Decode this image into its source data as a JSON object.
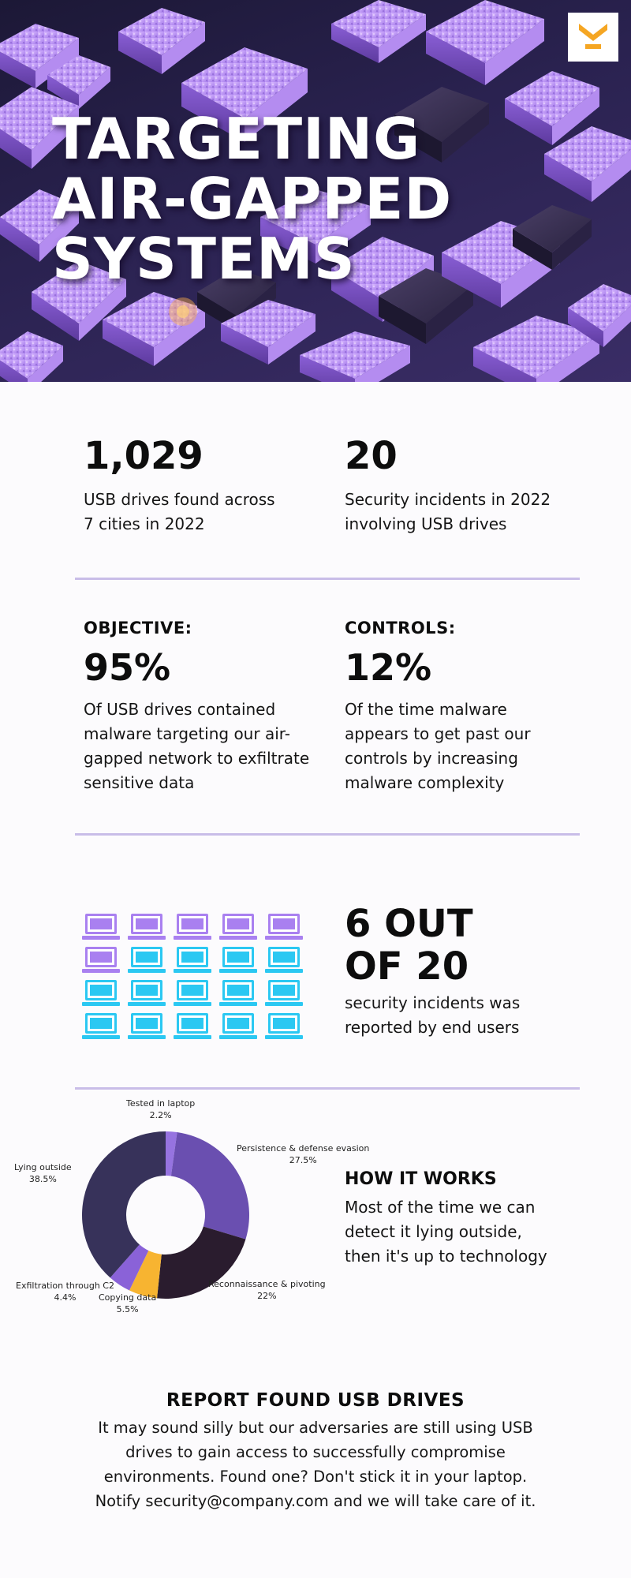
{
  "hero": {
    "title_lines": [
      "TARGETING",
      "AIR-GAPPED",
      "SYSTEMS"
    ],
    "logo_icon": "chevron-down-logo-icon",
    "accent_color": "#f5a623"
  },
  "stats": [
    {
      "number": "1,029",
      "desc_lines": [
        "USB drives found across",
        "7 cities in 2022"
      ]
    },
    {
      "number": "20",
      "desc_lines": [
        "Security incidents in 2022",
        "involving USB drives"
      ]
    }
  ],
  "objective": {
    "label": "OBJECTIVE:",
    "percent": "95%",
    "desc_lines": [
      "Of USB drives contained",
      "malware targeting our air-",
      "gapped network to exfiltrate",
      "sensitive data"
    ]
  },
  "controls": {
    "label": "CONTROLS:",
    "percent": "12%",
    "desc_lines": [
      "Of the time malware",
      "appears to get past our",
      "controls by increasing",
      "malware complexity"
    ]
  },
  "end_users": {
    "headline_lines": [
      "6 OUT",
      "OF 20"
    ],
    "desc_lines": [
      "security incidents was",
      "reported by end users"
    ],
    "icon": "laptop-icon",
    "highlighted": 6,
    "total": 20,
    "highlight_color": "#a980f0",
    "base_color": "#2bc8f2"
  },
  "chart_data": {
    "type": "pie",
    "donut": true,
    "slices": [
      {
        "label": "Tested in laptop",
        "value": 2.2,
        "display": "2.2%",
        "color": "#9673e0"
      },
      {
        "label": "Persistence & defense evasion",
        "value": 27.5,
        "display": "27.5%",
        "color": "#6a4fb0"
      },
      {
        "label": "Reconnaissance & pivoting",
        "value": 22,
        "display": "22%",
        "color": "#2a1c2e"
      },
      {
        "label": "Copying data",
        "value": 5.5,
        "display": "5.5%",
        "color": "#f7b431"
      },
      {
        "label": "Exfiltration through C2",
        "value": 4.4,
        "display": "4.4%",
        "color": "#8a62d8"
      },
      {
        "label": "Lying outside",
        "value": 38.5,
        "display": "38.5%",
        "color": "#37325a"
      }
    ]
  },
  "how_it_works": {
    "title": "HOW IT WORKS",
    "desc_lines": [
      "Most of the time we can",
      "detect it lying outside,",
      "then it's up to technology"
    ]
  },
  "report": {
    "title": "REPORT FOUND USB DRIVES",
    "desc_lines": [
      "It may sound silly but our adversaries are still using USB",
      "drives to gain access to successfully compromise",
      "environments. Found one? Don't stick it in your laptop.",
      "Notify security@company.com and we will take care of it."
    ]
  }
}
